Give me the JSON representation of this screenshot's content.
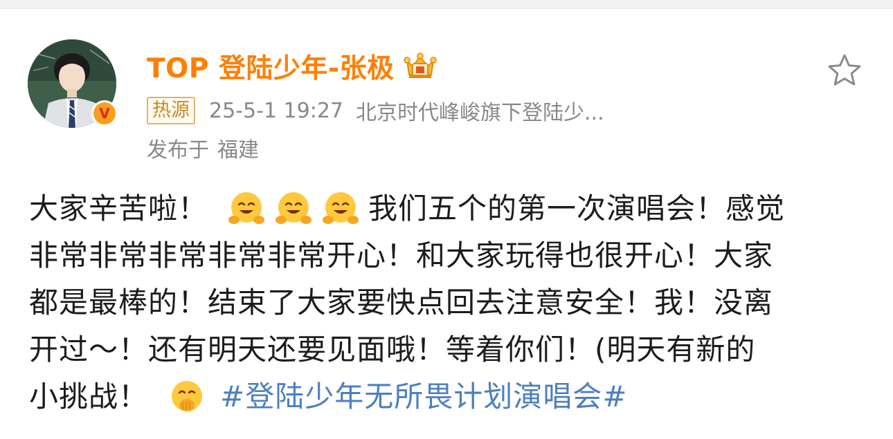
{
  "post": {
    "author": {
      "name": "TOP 登陆少年-张极",
      "verified_badge": "V",
      "crown_icon": "crown-icon",
      "name_color": "#ff7f00"
    },
    "meta": {
      "hot_badge": "热源",
      "time": "25-5-1 19:27",
      "source": "北京时代峰峻旗下登陆少..."
    },
    "location": {
      "label": "发布于",
      "value": "福建"
    },
    "content": {
      "line1_text": "大家辛苦啦！",
      "line1_rest": "我们五个的第一次演唱会！感觉",
      "line2": "非常非常非常非常非常开心！和大家玩得也很开心！大家",
      "line3": "都是最棒的！结束了大家要快点回去注意安全！我！没离",
      "line4": "开过～！还有明天还要见面哦！等着你们！(明天有新的",
      "line5_text": "小挑战！",
      "hashtag": "#登陆少年无所畏计划演唱会#",
      "hashtag_color": "#4c7fc0"
    },
    "icons": {
      "favorite": "star-icon",
      "hug_emoji": "hug-emoji-icon",
      "shush_emoji": "hand-over-mouth-emoji-icon"
    }
  }
}
